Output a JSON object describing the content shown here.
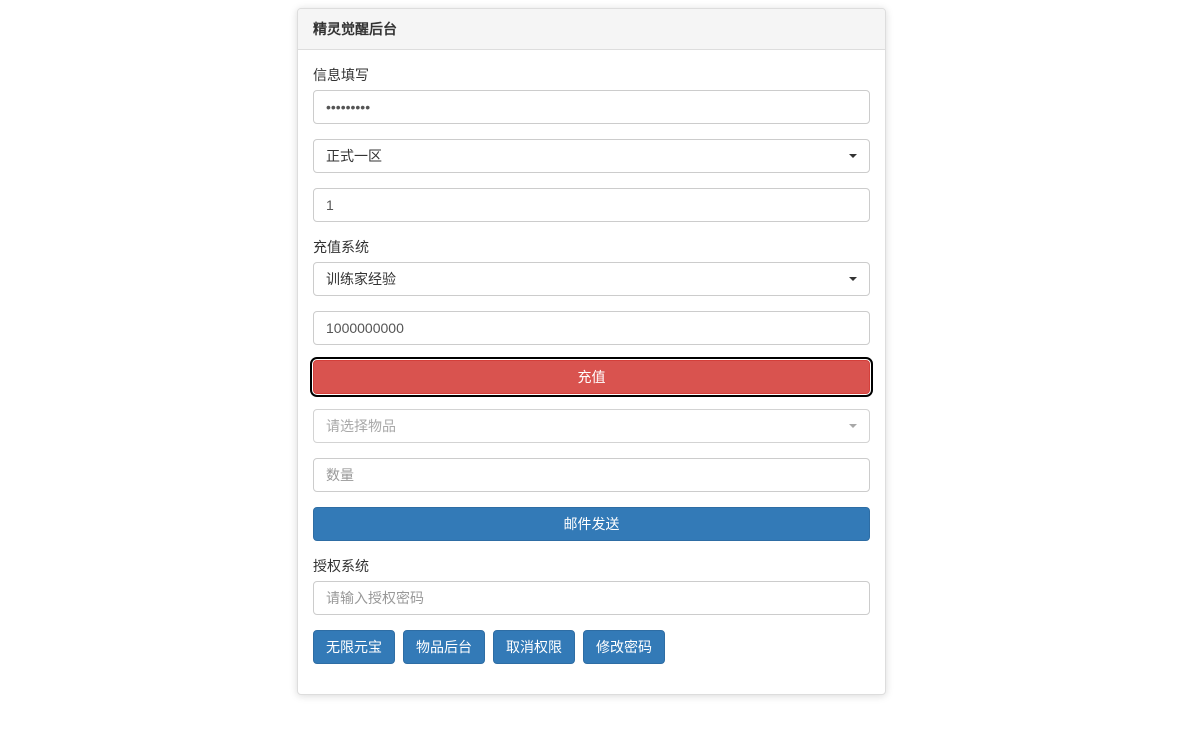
{
  "panel": {
    "title": "精灵觉醒后台"
  },
  "info": {
    "label": "信息填写",
    "password_value": "•••••••••",
    "server_selected": "正式一区",
    "player_id_value": "1"
  },
  "recharge": {
    "label": "充值系统",
    "type_selected": "训练家经验",
    "amount_value": "1000000000",
    "button_label": "充值"
  },
  "mail": {
    "item_placeholder": "请选择物品",
    "quantity_placeholder": "数量",
    "button_label": "邮件发送"
  },
  "auth": {
    "label": "授权系统",
    "password_placeholder": "请输入授权密码"
  },
  "buttons": {
    "unlimited_gold": "无限元宝",
    "item_backend": "物品后台",
    "cancel_auth": "取消权限",
    "change_password": "修改密码"
  }
}
